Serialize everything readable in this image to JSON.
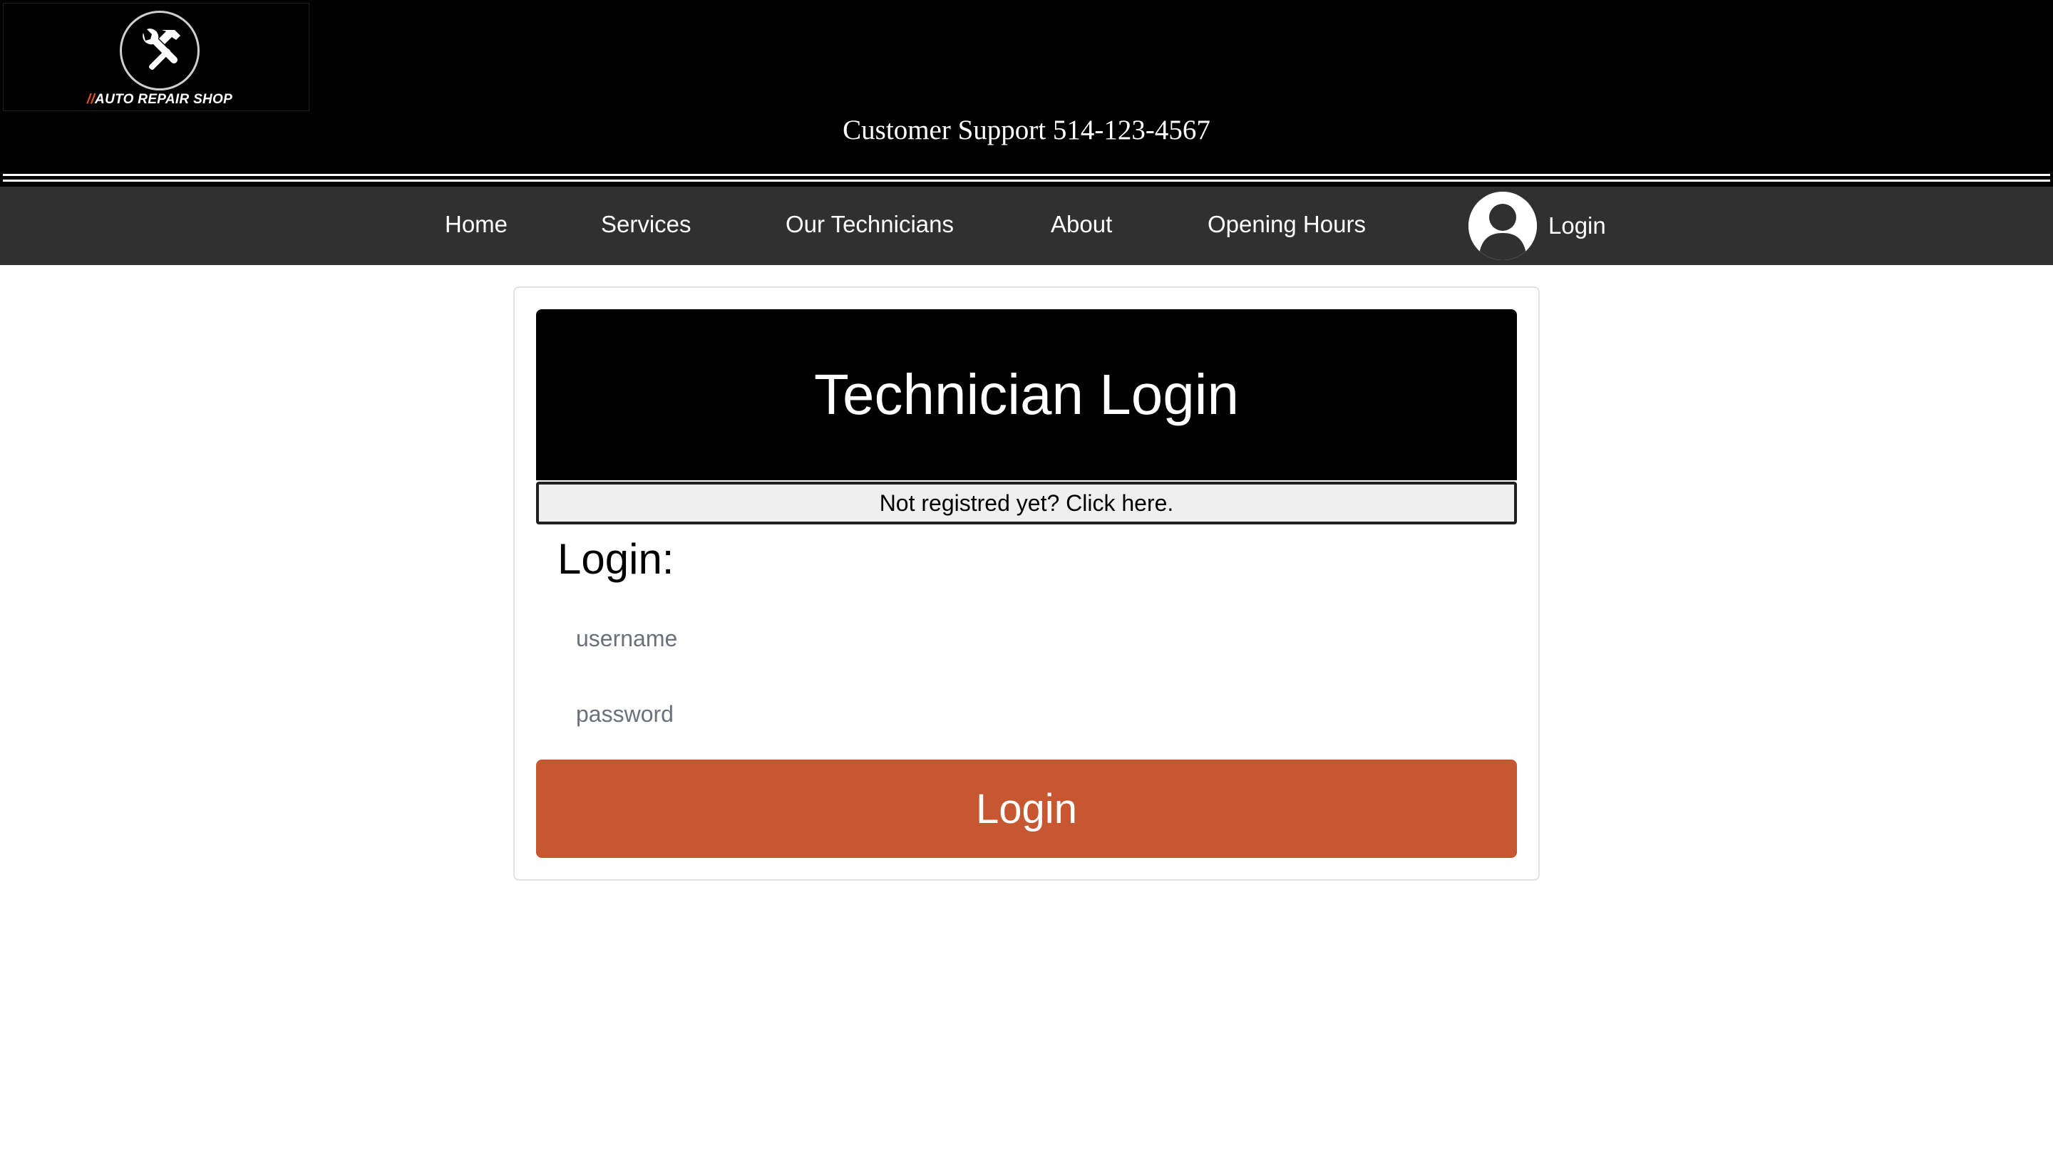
{
  "header": {
    "logo": {
      "icon": "hammer-wrench-icon",
      "slash_text": "//",
      "brand_text": "AUTO REPAIR SHOP"
    },
    "support_text": "Customer Support 514-123-4567"
  },
  "nav": {
    "items": [
      {
        "label": "Home"
      },
      {
        "label": "Services"
      },
      {
        "label": "Our Technicians"
      },
      {
        "label": "About"
      },
      {
        "label": "Opening Hours"
      }
    ],
    "login": {
      "icon": "user-avatar-icon",
      "label": "Login"
    }
  },
  "card": {
    "banner_title": "Technician Login",
    "register_link": "Not registred yet? Click here.",
    "form_title": "Login:",
    "username_placeholder": "username",
    "password_placeholder": "password",
    "submit_label": "Login"
  },
  "colors": {
    "header_bg": "#000000",
    "nav_bg": "#303030",
    "accent": "#c75731",
    "logo_slash": "#e8541e"
  }
}
